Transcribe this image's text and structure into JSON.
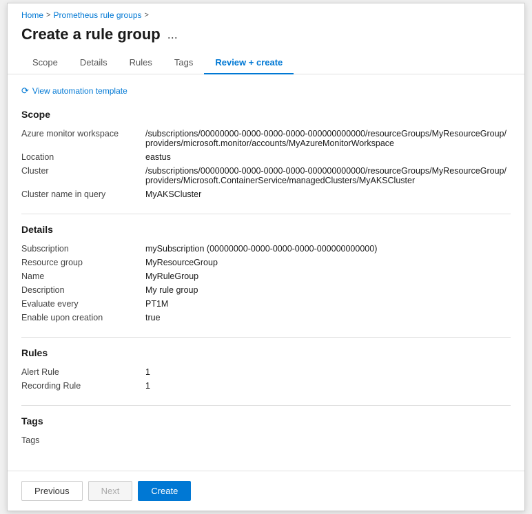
{
  "breadcrumb": {
    "home": "Home",
    "separator1": ">",
    "prometheus": "Prometheus rule groups",
    "separator2": ">"
  },
  "pageTitle": "Create a rule group",
  "pageMenuIcon": "...",
  "tabs": [
    {
      "id": "scope",
      "label": "Scope",
      "active": false
    },
    {
      "id": "details",
      "label": "Details",
      "active": false
    },
    {
      "id": "rules",
      "label": "Rules",
      "active": false
    },
    {
      "id": "tags",
      "label": "Tags",
      "active": false
    },
    {
      "id": "review-create",
      "label": "Review + create",
      "active": true
    }
  ],
  "automationLink": "View automation template",
  "sections": {
    "scope": {
      "title": "Scope",
      "fields": [
        {
          "label": "Azure monitor workspace",
          "value": "/subscriptions/00000000-0000-0000-0000-000000000000/resourceGroups/MyResourceGroup/providers/microsoft.monitor/accounts/MyAzureMonitorWorkspace"
        },
        {
          "label": "Location",
          "value": "eastus"
        },
        {
          "label": "Cluster",
          "value": "/subscriptions/00000000-0000-0000-0000-000000000000/resourceGroups/MyResourceGroup/providers/Microsoft.ContainerService/managedClusters/MyAKSCluster"
        },
        {
          "label": "Cluster name in query",
          "value": "MyAKSCluster"
        }
      ]
    },
    "details": {
      "title": "Details",
      "fields": [
        {
          "label": "Subscription",
          "value": "mySubscription (00000000-0000-0000-0000-000000000000)"
        },
        {
          "label": "Resource group",
          "value": "MyResourceGroup"
        },
        {
          "label": "Name",
          "value": "MyRuleGroup"
        },
        {
          "label": "Description",
          "value": "My rule group"
        },
        {
          "label": "Evaluate every",
          "value": "PT1M"
        },
        {
          "label": "Enable upon creation",
          "value": "true"
        }
      ]
    },
    "rules": {
      "title": "Rules",
      "fields": [
        {
          "label": "Alert Rule",
          "value": "1"
        },
        {
          "label": "Recording Rule",
          "value": "1"
        }
      ]
    },
    "tags": {
      "title": "Tags",
      "fields": [
        {
          "label": "Tags",
          "value": ""
        }
      ]
    }
  },
  "footer": {
    "previous": "Previous",
    "next": "Next",
    "create": "Create"
  }
}
